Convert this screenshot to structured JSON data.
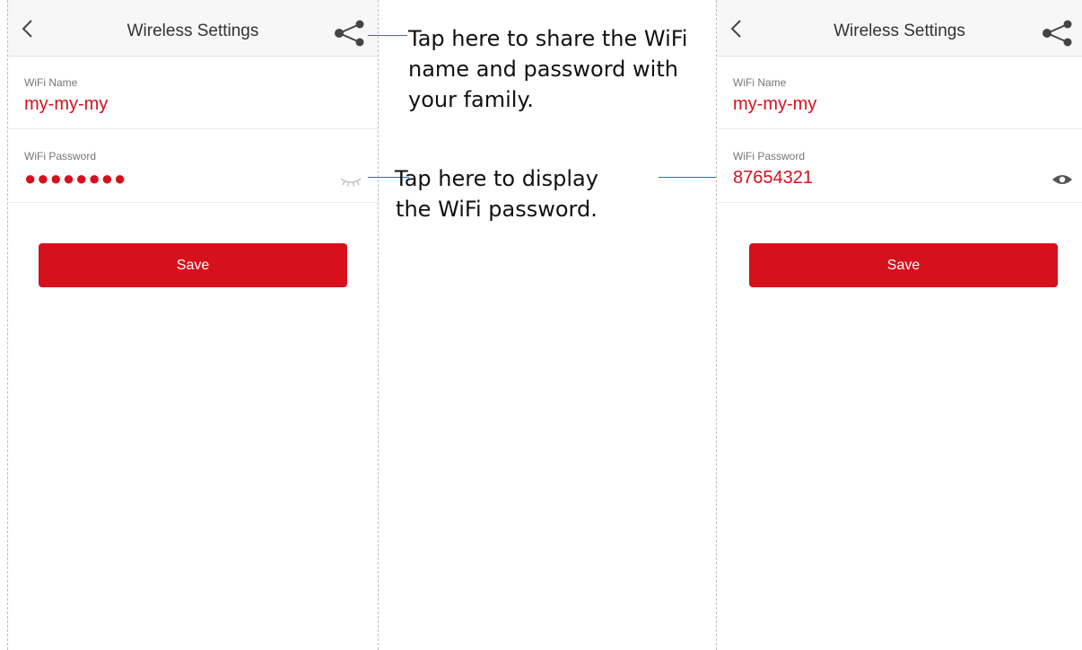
{
  "screens": [
    {
      "nav_title": "Wireless Settings",
      "wifi_name_label": "WiFi Name",
      "wifi_name_value": "my-my-my",
      "wifi_password_label": "WiFi Password",
      "wifi_password_value": "●●●●●●●●",
      "password_visible": false,
      "save_label": "Save"
    },
    {
      "nav_title": "Wireless Settings",
      "wifi_name_label": "WiFi Name",
      "wifi_name_value": "my-my-my",
      "wifi_password_label": "WiFi Password",
      "wifi_password_value": "87654321",
      "password_visible": true,
      "save_label": "Save"
    }
  ],
  "annotations": {
    "share": "Tap here to share the WiFi\nname and password with\nyour family.",
    "display_password": "Tap here to display\nthe WiFi password."
  },
  "colors": {
    "accent": "#d7111c",
    "value_text": "#d6101d",
    "leader_line": "#2e6fbf",
    "navbar_bg": "#f7f7f7"
  },
  "icons": {
    "back": "chevron-left-icon",
    "share": "share-icon",
    "password_hidden": "eye-closed-icon",
    "password_shown": "eye-icon"
  }
}
